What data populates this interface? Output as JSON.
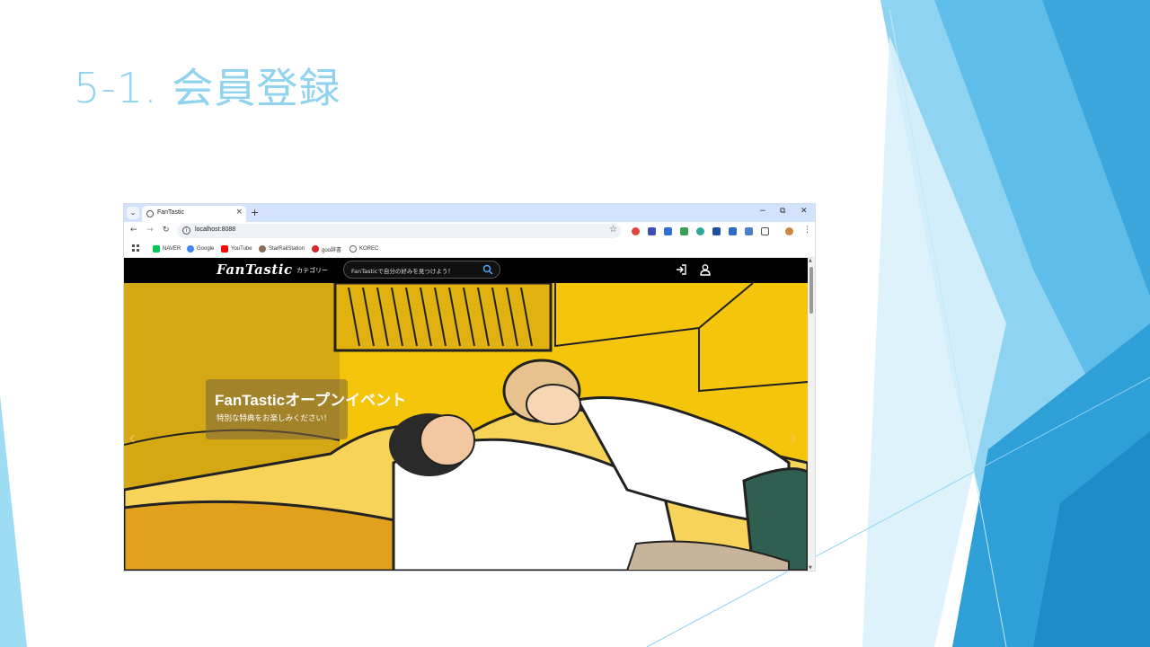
{
  "slide": {
    "title": "5-1. 会員登録"
  },
  "browser": {
    "tab": {
      "title": "FanTastic",
      "close": "×"
    },
    "new_tab": "+",
    "window_controls": {
      "minimize": "−",
      "restore": "⧉",
      "close": "✕"
    },
    "nav": {
      "back": "←",
      "forward": "→",
      "reload": "↻"
    },
    "address": "localhost:8088",
    "bookmarks": [
      {
        "label": "NAVER",
        "icon_color": "#03c75a",
        "icon": "naver-icon"
      },
      {
        "label": "Google",
        "icon_color": "#4285f4",
        "icon": "google-icon"
      },
      {
        "label": "YouTube",
        "icon_color": "#ff0000",
        "icon": "youtube-icon"
      },
      {
        "label": "StarRailStation",
        "icon_color": "#8a6d5a",
        "icon": "starrail-icon"
      },
      {
        "label": "goo辞書",
        "icon_color": "#d8262f",
        "icon": "goo-icon"
      },
      {
        "label": "KOREC",
        "icon_color": "#666666",
        "icon": "korec-icon"
      }
    ]
  },
  "site": {
    "logo": "FanTastic",
    "category": "カテゴリー",
    "search_placeholder": "FanTasticで自分の好みを見つけよう！",
    "hero": {
      "title": "FanTasticオープンイベント",
      "subtitle": "特別な特典をお楽しみください！",
      "prev": "‹",
      "next": "›"
    }
  }
}
